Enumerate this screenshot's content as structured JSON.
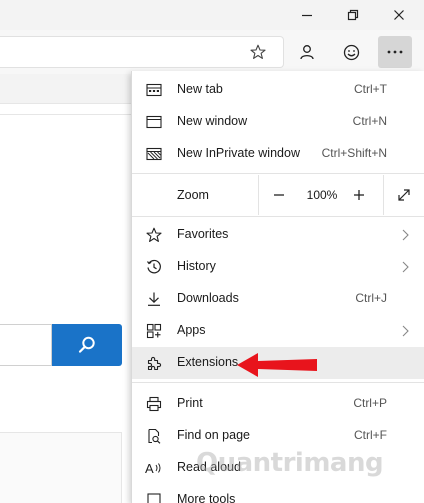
{
  "window_controls": {
    "minimize_icon": "minimize-icon",
    "maximize_icon": "restore-icon",
    "close_icon": "close-icon"
  },
  "toolbar": {
    "favorite_icon": "star-icon",
    "profile_icon": "profile-icon",
    "feedback_icon": "smiley-icon",
    "more_icon": "more-dots-icon"
  },
  "page": {
    "search_icon": "search-icon",
    "search_button_color": "#1a73c8"
  },
  "menu": {
    "items": [
      {
        "label": "New tab",
        "shortcut": "Ctrl+T",
        "icon": "new-tab-icon"
      },
      {
        "label": "New window",
        "shortcut": "Ctrl+N",
        "icon": "new-window-icon"
      },
      {
        "label": "New InPrivate window",
        "shortcut": "Ctrl+Shift+N",
        "icon": "inprivate-icon"
      },
      {
        "label": "Favorites",
        "icon": "star-icon",
        "submenu": true
      },
      {
        "label": "History",
        "icon": "history-icon",
        "submenu": true
      },
      {
        "label": "Downloads",
        "shortcut": "Ctrl+J",
        "icon": "download-icon"
      },
      {
        "label": "Apps",
        "icon": "apps-icon",
        "submenu": true
      },
      {
        "label": "Extensions",
        "icon": "extensions-icon",
        "highlighted": true
      },
      {
        "label": "Print",
        "shortcut": "Ctrl+P",
        "icon": "print-icon"
      },
      {
        "label": "Find on page",
        "shortcut": "Ctrl+F",
        "icon": "find-icon"
      },
      {
        "label": "Read aloud",
        "icon": "read-aloud-icon"
      },
      {
        "label": "More tools",
        "icon": "more-tools-icon"
      }
    ],
    "zoom": {
      "label": "Zoom",
      "value": "100%",
      "decrease_icon": "minus-icon",
      "increase_icon": "plus-icon",
      "fullscreen_icon": "fullscreen-icon"
    }
  },
  "annotation": {
    "arrow_color": "#e8141c",
    "arrow_target": "Extensions"
  },
  "watermark": {
    "text": "Quantrimang"
  }
}
